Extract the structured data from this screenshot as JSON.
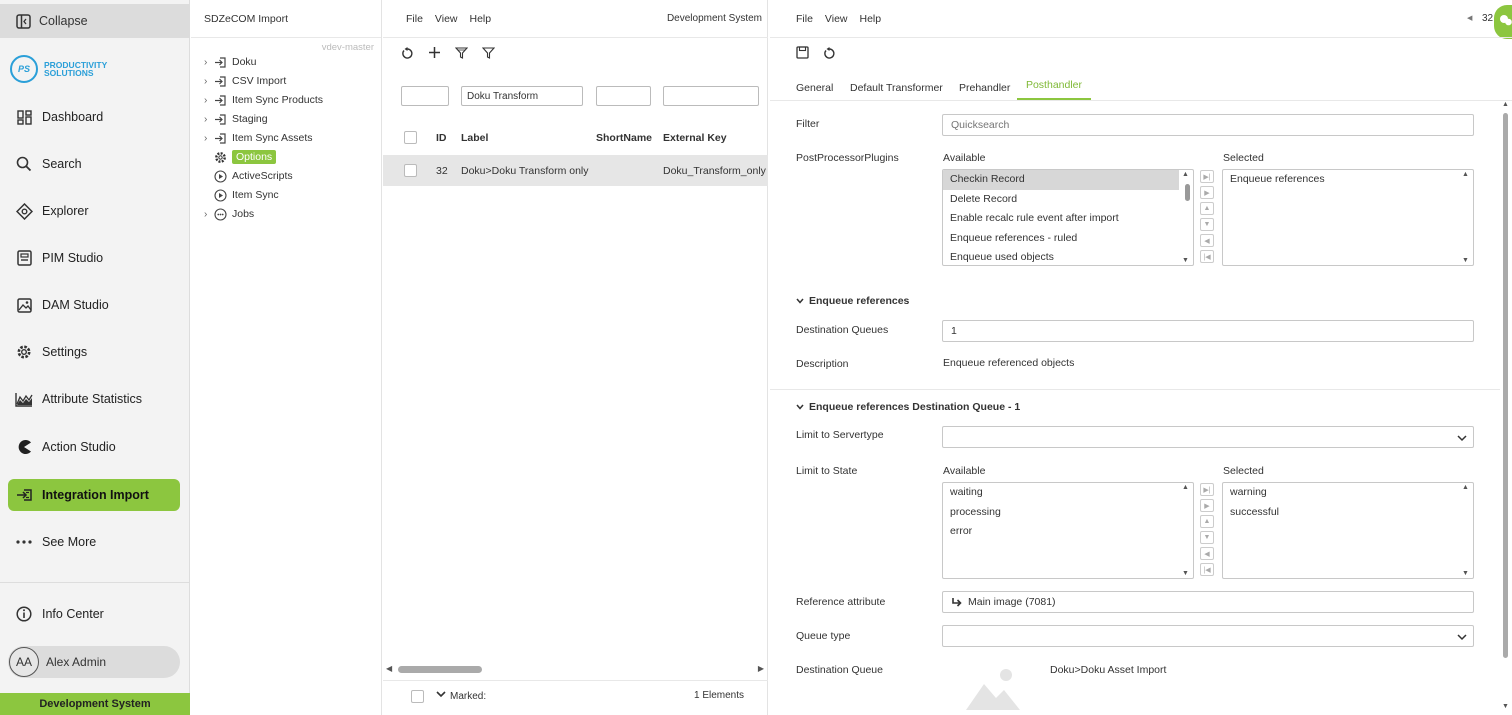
{
  "sidebar": {
    "collapse_label": "Collapse",
    "logo_text_line1": "PRODUCTIVITY",
    "logo_text_line2": "SOLUTIONS",
    "logo_badge": "PS",
    "items": [
      {
        "label": "Dashboard",
        "icon": "dashboard-icon"
      },
      {
        "label": "Search",
        "icon": "search-icon"
      },
      {
        "label": "Explorer",
        "icon": "explorer-icon"
      },
      {
        "label": "PIM Studio",
        "icon": "pim-icon"
      },
      {
        "label": "DAM Studio",
        "icon": "image-icon"
      },
      {
        "label": "Settings",
        "icon": "gear-icon"
      },
      {
        "label": "Attribute Statistics",
        "icon": "chart-icon"
      },
      {
        "label": "Action Studio",
        "icon": "pacman-icon"
      },
      {
        "label": "Integration Import",
        "icon": "import-icon"
      },
      {
        "label": "See More",
        "icon": "dots-icon"
      }
    ],
    "info_center": "Info Center",
    "user_initials": "AA",
    "user_name": "Alex Admin",
    "system_label": "Development System",
    "accent": "#8cc63f"
  },
  "tree": {
    "title": "SDZeCOM Import",
    "version": "vdev-master",
    "items": [
      {
        "label": "Doku",
        "expandable": true
      },
      {
        "label": "CSV Import",
        "expandable": true
      },
      {
        "label": "Item Sync Products",
        "expandable": true
      },
      {
        "label": "Staging",
        "expandable": true
      },
      {
        "label": "Item Sync Assets",
        "expandable": true
      },
      {
        "label": "Options",
        "expandable": false
      },
      {
        "label": "ActiveScripts",
        "expandable": false
      },
      {
        "label": "Item Sync",
        "expandable": false
      },
      {
        "label": "Jobs",
        "expandable": true
      }
    ]
  },
  "list": {
    "menu": [
      "File",
      "View",
      "Help"
    ],
    "system": "Development System",
    "filter_label_value": "Doku Transform",
    "columns": [
      "ID",
      "Label",
      "ShortName",
      "External Key"
    ],
    "rows": [
      {
        "id": "32",
        "label": "Doku>Doku Transform only",
        "shortname": "",
        "external_key": "Doku_Transform_only"
      }
    ],
    "marked_label": "Marked:",
    "count_label": "1 Elements"
  },
  "detail": {
    "menu": [
      "File",
      "View",
      "Help"
    ],
    "corner_id": "32",
    "tabs": [
      "General",
      "Default Transformer",
      "Prehandler",
      "Posthandler"
    ],
    "active_tab": "Posthandler",
    "filter_label": "Filter",
    "filter_placeholder": "Quicksearch",
    "plugins_label": "PostProcessorPlugins",
    "available_label": "Available",
    "selected_label": "Selected",
    "plugins_available": [
      "Checkin Record",
      "Delete Record",
      "Enable recalc rule event after import",
      "Enqueue references - ruled",
      "Enqueue used objects"
    ],
    "plugins_selected": [
      "Enqueue references"
    ],
    "section1_title": "Enqueue references",
    "dest_queues_label": "Destination Queues",
    "dest_queues_value": "1",
    "description_label": "Description",
    "description_value": "Enqueue referenced objects",
    "section2_title": "Enqueue references Destination Queue - 1",
    "servertype_label": "Limit to Servertype",
    "state_label": "Limit to State",
    "state_available": [
      "waiting",
      "processing",
      "error"
    ],
    "state_selected": [
      "warning",
      "successful"
    ],
    "ref_attr_label": "Reference attribute",
    "ref_attr_value": "Main image (7081)",
    "queue_type_label": "Queue type",
    "dest_queue_label": "Destination Queue",
    "dest_queue_value": "Doku>Doku Asset Import"
  }
}
